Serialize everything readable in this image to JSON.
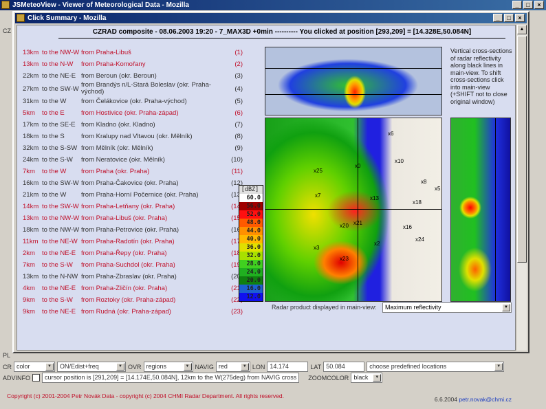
{
  "outer_window": {
    "title": "JSMeteoView - Viewer of Meteorological Data - Mozilla"
  },
  "popup": {
    "title": "Click Summary - Mozilla",
    "header": "CZRAD composite - 08.06.2003 19:20 - 7_MAX3D +0min ---------- You clicked at position [293,209] = [14.328E,50.084N]"
  },
  "rows": [
    {
      "dist": "13km",
      "dir": "to the NW-W",
      "from": "from Praha-Libuš",
      "num": "(1)",
      "red": true
    },
    {
      "dist": "13km",
      "dir": "to the N-W",
      "from": "from Praha-Komořany",
      "num": "(2)",
      "red": true
    },
    {
      "dist": "22km",
      "dir": "to the NE-E",
      "from": "from Beroun (okr. Beroun)",
      "num": "(3)",
      "red": false
    },
    {
      "dist": "27km",
      "dir": "to the SW-W",
      "from": "from Brandýs n/L-Stará Boleslav (okr. Praha-východ)",
      "num": "(4)",
      "red": false
    },
    {
      "dist": "31km",
      "dir": "to the W",
      "from": "from Čelákovice (okr. Praha-východ)",
      "num": "(5)",
      "red": false
    },
    {
      "dist": "5km",
      "dir": "to the E",
      "from": "from Hostivice (okr. Praha-západ)",
      "num": "(6)",
      "red": true
    },
    {
      "dist": "17km",
      "dir": "to the SE-E",
      "from": "from Kladno (okr. Kladno)",
      "num": "(7)",
      "red": false
    },
    {
      "dist": "18km",
      "dir": "to the S",
      "from": "from Kralupy nad Vltavou (okr. Mělník)",
      "num": "(8)",
      "red": false
    },
    {
      "dist": "32km",
      "dir": "to the S-SW",
      "from": "from Mělník (okr. Mělník)",
      "num": "(9)",
      "red": false
    },
    {
      "dist": "24km",
      "dir": "to the S-W",
      "from": "from Neratovice (okr. Mělník)",
      "num": "(10)",
      "red": false
    },
    {
      "dist": "7km",
      "dir": "to the W",
      "from": "from Praha (okr. Praha)",
      "num": "(11)",
      "red": true
    },
    {
      "dist": "16km",
      "dir": "to the SW-W",
      "from": "from Praha-Čakovice (okr. Praha)",
      "num": "(12)",
      "red": false
    },
    {
      "dist": "21km",
      "dir": "to the W",
      "from": "from Praha-Horní Počernice (okr. Praha)",
      "num": "(13)",
      "red": false
    },
    {
      "dist": "14km",
      "dir": "to the SW-W",
      "from": "from Praha-Letňany (okr. Praha)",
      "num": "(14)",
      "red": true
    },
    {
      "dist": "13km",
      "dir": "to the NW-W",
      "from": "from Praha-Libuš (okr. Praha)",
      "num": "(15)",
      "red": true
    },
    {
      "dist": "18km",
      "dir": "to the NW-W",
      "from": "from Praha-Petrovice (okr. Praha)",
      "num": "(16)",
      "red": false
    },
    {
      "dist": "11km",
      "dir": "to the NE-W",
      "from": "from Praha-Radotín (okr. Praha)",
      "num": "(17)",
      "red": true
    },
    {
      "dist": "2km",
      "dir": "to the NE-E",
      "from": "from Praha-Řepy (okr. Praha)",
      "num": "(18)",
      "red": true
    },
    {
      "dist": "7km",
      "dir": "to the S-W",
      "from": "from Praha-Suchdol (okr. Praha)",
      "num": "(19)",
      "red": true
    },
    {
      "dist": "13km",
      "dir": "to the N-NW",
      "from": "from Praha-Zbraslav (okr. Praha)",
      "num": "(20)",
      "red": false
    },
    {
      "dist": "4km",
      "dir": "to the NE-E",
      "from": "from Praha-Zličín (okr. Praha)",
      "num": "(21)",
      "red": true
    },
    {
      "dist": "9km",
      "dir": "to the S-W",
      "from": "from Roztoky (okr. Praha-západ)",
      "num": "(22)",
      "red": true
    },
    {
      "dist": "9km",
      "dir": "to the NE-E",
      "from": "from Rudná (okr. Praha-západ)",
      "num": "(23)",
      "red": true
    }
  ],
  "legend": {
    "unit": "[dBZ]",
    "items": [
      {
        "v": "60.0",
        "c": "#ffffff"
      },
      {
        "v": "56.0",
        "c": "#a00000"
      },
      {
        "v": "52.0",
        "c": "#ff1010"
      },
      {
        "v": "48.0",
        "c": "#ff5a00"
      },
      {
        "v": "44.0",
        "c": "#ff9000"
      },
      {
        "v": "40.0",
        "c": "#ffb800"
      },
      {
        "v": "36.0",
        "c": "#e0e000"
      },
      {
        "v": "32.0",
        "c": "#a8e000"
      },
      {
        "v": "28.0",
        "c": "#40d020"
      },
      {
        "v": "24.0",
        "c": "#20b020"
      },
      {
        "v": "20.0",
        "c": "#108010"
      },
      {
        "v": "16.0",
        "c": "#1c60d0"
      },
      {
        "v": "12.0",
        "c": "#1010f0"
      }
    ]
  },
  "notes": "Vertical cross-sections of radar reflectivity along black lines in main-view. To shift cross-sections click into main-view (+SHIFT not to close original window)",
  "map_markers": [
    "x6",
    "x10",
    "x25",
    "x0",
    "x8",
    "x5",
    "x7",
    "x13",
    "x18",
    "x16",
    "x21",
    "x20",
    "x24",
    "x3",
    "x2",
    "x23"
  ],
  "product": {
    "label": "Radar product displayed in main-view:",
    "value": "Maximum reflectivity"
  },
  "controls": {
    "cr_label": "CR",
    "cr_value": "color",
    "unit_value": "ON/Edist+freq",
    "ovr_label": "OVR",
    "ovr_value": "regions",
    "navig_label": "NAVIG",
    "navig_value": "red",
    "lon_label": "LON",
    "lon_value": "14.174",
    "lat_label": "LAT",
    "lat_value": "50.084",
    "locations": "choose predefined locations",
    "advinfo_label": "ADVINFO",
    "cursor_text": "cursor position is [291,209] = [14.174E,50.084N], 12km to the W(275deg) from NAVIG cross",
    "zoom_label": "ZOOMCOLOR",
    "zoom_value": "black"
  },
  "left_labels": {
    "c2": "CZ",
    "pl": "PL"
  },
  "footer": {
    "copyright": "Copyright (c) 2001-2004 Petr Novák Data - copyright (c) 2004 CHMI Radar Department. All rights reserved.",
    "version": "6.6.2004",
    "email": "petr.novak@chmi.cz"
  }
}
